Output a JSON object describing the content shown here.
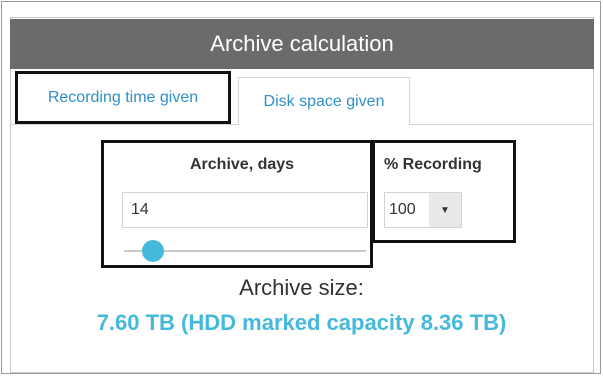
{
  "header": {
    "title": "Archive calculation"
  },
  "tabs": [
    {
      "label": "Recording time given",
      "active": true
    },
    {
      "label": "Disk space given",
      "active": false
    }
  ],
  "archive_days": {
    "label": "Archive, days",
    "value": "14",
    "slider_fraction": 0.12
  },
  "recording": {
    "label": "% Recording",
    "value": "100",
    "caret": "▼"
  },
  "result": {
    "label": "Archive size:",
    "value": "7.60 TB (HDD marked capacity 8.36 TB)"
  },
  "colors": {
    "header_bg": "#6b6b6b",
    "accent": "#45b9dc",
    "tab_text": "#2f8fc7"
  }
}
